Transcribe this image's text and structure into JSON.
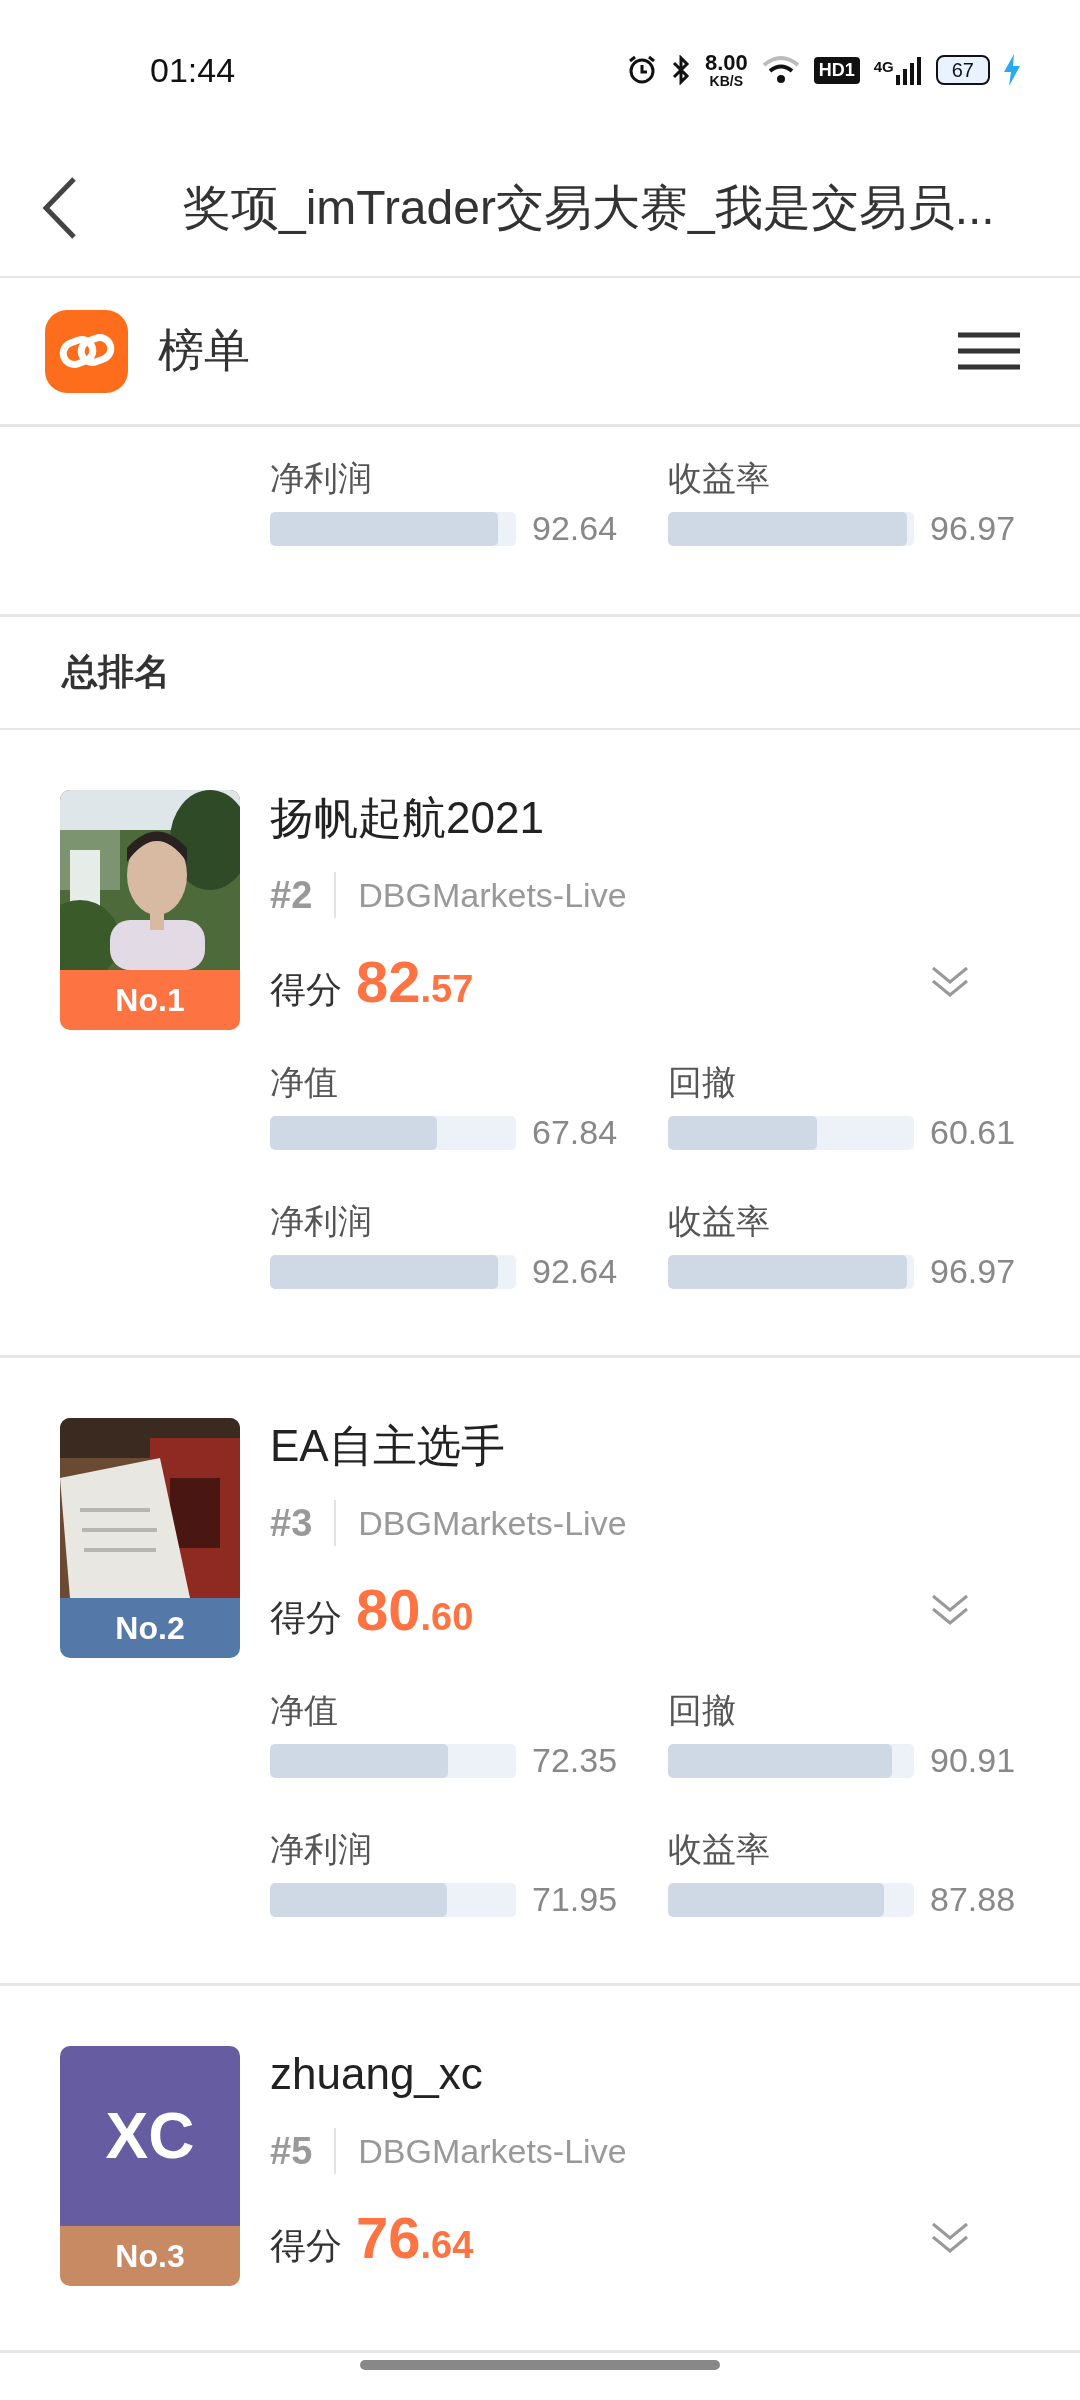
{
  "status_bar": {
    "time": "01:44",
    "speed": "8.00",
    "speed_unit": "KB/S",
    "hd_badge": "HD1",
    "network": "4G",
    "battery": "67"
  },
  "title_bar": {
    "title": "奖项_imTrader交易大赛_我是交易员..."
  },
  "sub_header": {
    "title": "榜单"
  },
  "partial_card": {
    "metrics": [
      {
        "label": "净利润",
        "value": "92.64",
        "level": 0.9264
      },
      {
        "label": "收益率",
        "value": "96.97",
        "level": 0.9697
      }
    ]
  },
  "section": {
    "title": "总排名"
  },
  "cards": [
    {
      "badge": {
        "text": "No.1",
        "color": "#fd7442"
      },
      "name": "扬帆起航2021",
      "rank": "#2",
      "server": "DBGMarkets-Live",
      "score_label": "得分",
      "score_whole": "82",
      "score_fraction": ".57",
      "metrics": [
        {
          "label": "净值",
          "value": "67.84",
          "level": 0.6784
        },
        {
          "label": "回撤",
          "value": "60.61",
          "level": 0.6061
        },
        {
          "label": "净利润",
          "value": "92.64",
          "level": 0.9264
        },
        {
          "label": "收益率",
          "value": "96.97",
          "level": 0.9697
        }
      ]
    },
    {
      "badge": {
        "text": "No.2",
        "color": "#5479a9"
      },
      "name": "EA自主选手",
      "rank": "#3",
      "server": "DBGMarkets-Live",
      "score_label": "得分",
      "score_whole": "80",
      "score_fraction": ".60",
      "metrics": [
        {
          "label": "净值",
          "value": "72.35",
          "level": 0.7235
        },
        {
          "label": "回撤",
          "value": "90.91",
          "level": 0.9091
        },
        {
          "label": "净利润",
          "value": "71.95",
          "level": 0.7195
        },
        {
          "label": "收益率",
          "value": "87.88",
          "level": 0.8788
        }
      ]
    },
    {
      "avatar": {
        "kind": "initials",
        "initials": "XC",
        "color": "#665ca1"
      },
      "badge": {
        "text": "No.3",
        "color": "#c78a62"
      },
      "name": "zhuang_xc",
      "rank": "#5",
      "server": "DBGMarkets-Live",
      "score_label": "得分",
      "score_whole": "76",
      "score_fraction": ".64"
    }
  ]
}
